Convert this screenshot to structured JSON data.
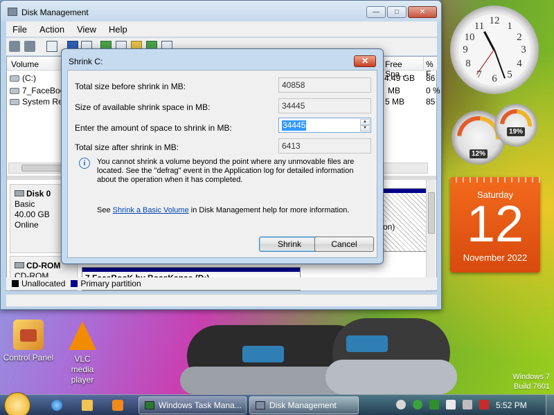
{
  "desktop": {
    "icons": [
      {
        "label": "Control Panel"
      },
      {
        "label": "VLC media player"
      }
    ],
    "watermark": {
      "line1": "Windows 7",
      "line2": "Build 7601"
    }
  },
  "gadgets": {
    "cpu_meter": {
      "value1": "12%",
      "value2": "19%"
    },
    "calendar": {
      "weekday": "Saturday",
      "day": "12",
      "month_year": "November 2022"
    },
    "clock_numbers": [
      "12",
      "1",
      "2",
      "3",
      "4",
      "5",
      "6",
      "7",
      "8",
      "9",
      "10",
      "11"
    ]
  },
  "window": {
    "title": "Disk Management",
    "menu": [
      "File",
      "Action",
      "View",
      "Help"
    ],
    "columns": {
      "volume": "Volume",
      "free_space": "Free Spa...",
      "pct_free": "% F"
    },
    "volumes": [
      {
        "name": "(C:)",
        "free": "4.49 GB",
        "pct": "86"
      },
      {
        "name": "7_FaceBoo",
        "free": "MB",
        "pct": "0 %"
      },
      {
        "name": "System Res",
        "free": "5 MB",
        "pct": "85"
      }
    ],
    "disks": [
      {
        "name": "Disk 0",
        "type": "Basic",
        "size": "40.00 GB",
        "status": "Online",
        "partition_tail": "on)"
      },
      {
        "name": "CD-ROM",
        "type": "CD-ROM",
        "partition": "7 FaceBooK by BossKanae (D:)"
      }
    ],
    "legend": {
      "unallocated": "Unallocated",
      "primary": "Primary partition",
      "unallocated_color": "#000000",
      "primary_color": "#00008b"
    }
  },
  "dialog": {
    "title": "Shrink C:",
    "close": "✕",
    "fields": [
      {
        "label": "Total size before shrink in MB:",
        "value": "40858"
      },
      {
        "label": "Size of available shrink space in MB:",
        "value": "34445"
      },
      {
        "label": "Enter the amount of space to shrink in MB:",
        "value": "34445"
      },
      {
        "label": "Total size after shrink in MB:",
        "value": "6413"
      }
    ],
    "info": "You cannot shrink a volume beyond the point where any unmovable files are located. See the \"defrag\" event in the Application log for detailed information about the operation when it has completed.",
    "see_prefix": "See ",
    "see_link": "Shrink a Basic Volume",
    "see_suffix": " in Disk Management help for more information.",
    "shrink_button": "Shrink",
    "cancel_button": "Cancel"
  },
  "taskbar": {
    "tasks": [
      "Windows Task Mana...",
      "Disk Management"
    ],
    "time": "5:52 PM"
  }
}
